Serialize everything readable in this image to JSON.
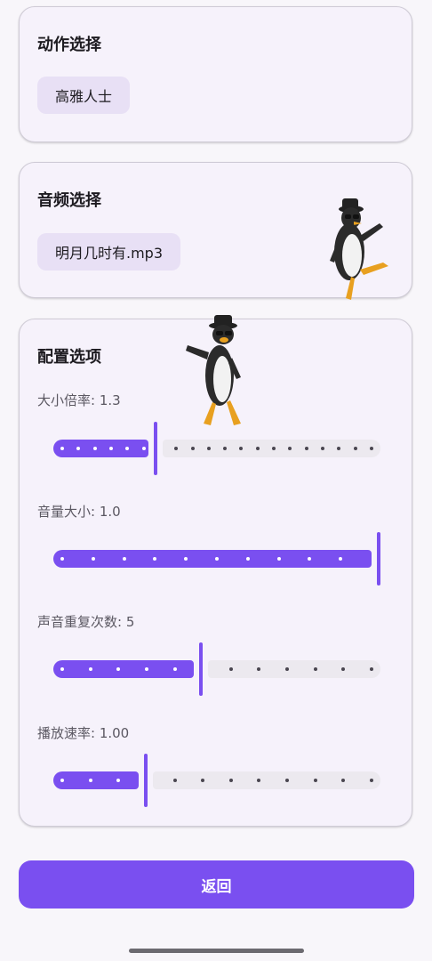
{
  "colors": {
    "accent": "#7a4ff0",
    "chip_bg": "#e8e0f5",
    "card_bg": "#f6f2fb",
    "track_inactive": "#ece9ef"
  },
  "action_card": {
    "title": "动作选择",
    "selected": "高雅人士"
  },
  "audio_card": {
    "title": "音频选择",
    "selected": "明月几时有.mp3"
  },
  "config_card": {
    "title": "配置选项",
    "sliders": [
      {
        "label": "大小倍率: 1.3",
        "fraction": 0.31,
        "ticks": 20
      },
      {
        "label": "音量大小: 1.0",
        "fraction": 1.0,
        "ticks": 11
      },
      {
        "label": "声音重复次数: 5",
        "fraction": 0.45,
        "ticks": 12
      },
      {
        "label": "播放速率: 1.00",
        "fraction": 0.28,
        "ticks": 12
      }
    ]
  },
  "footer": {
    "back_label": "返回"
  },
  "mascot": {
    "icon": "penguin-dancer-icon"
  }
}
